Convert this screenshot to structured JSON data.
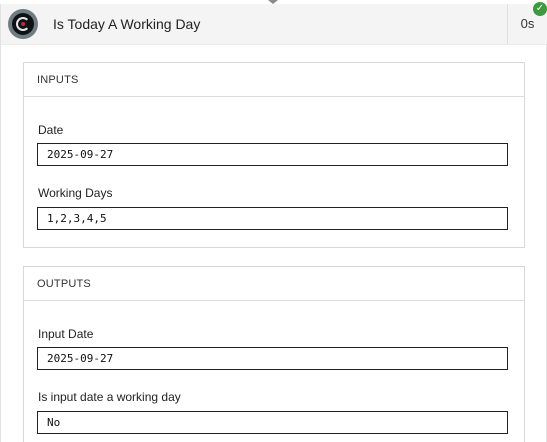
{
  "header": {
    "title": "Is Today A Working Day",
    "duration": "0s",
    "status_icon": "check-circle-icon",
    "status_color": "#3b9a3b"
  },
  "inputs": {
    "section_title": "INPUTS",
    "fields": [
      {
        "label": "Date",
        "value": "2025-09-27"
      },
      {
        "label": "Working Days",
        "value": "1,2,3,4,5"
      }
    ]
  },
  "outputs": {
    "section_title": "OUTPUTS",
    "fields": [
      {
        "label": "Input Date",
        "value": "2025-09-27"
      },
      {
        "label": "Is input date a working day",
        "value": "No"
      }
    ]
  }
}
